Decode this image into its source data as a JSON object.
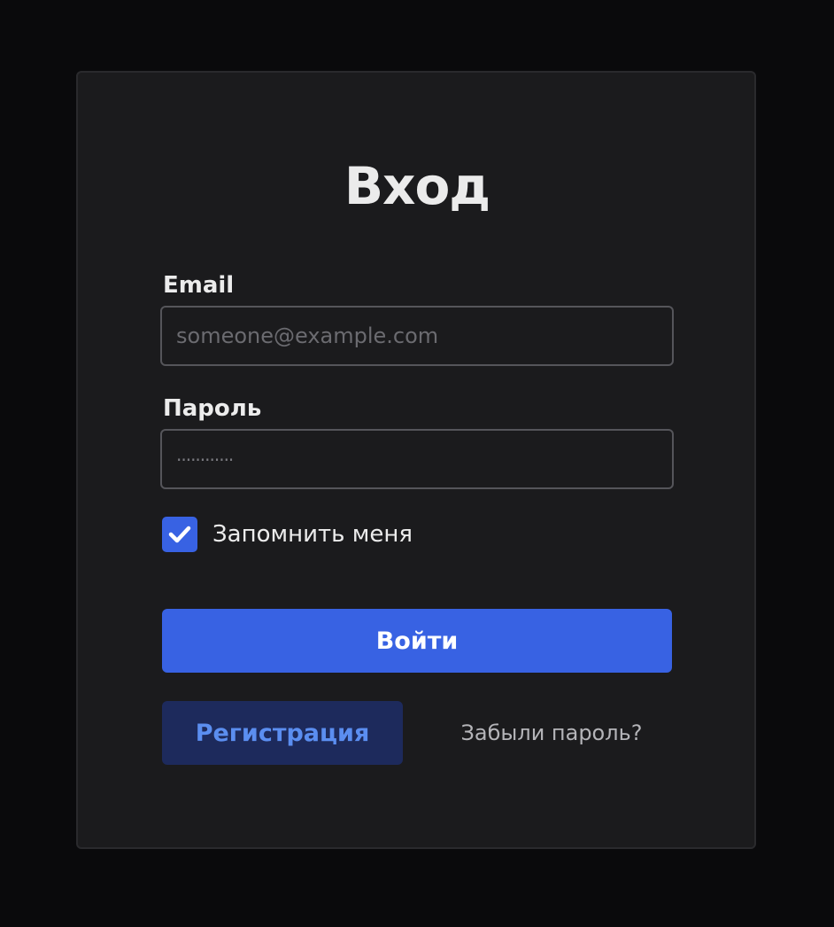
{
  "login": {
    "title": "Вход",
    "email_label": "Email",
    "email_placeholder": "someone@example.com",
    "email_value": "",
    "password_label": "Пароль",
    "password_placeholder": "············",
    "remember_label": "Запомнить меня",
    "remember_checked": true,
    "submit_label": "Войти",
    "register_label": "Регистрация",
    "forgot_label": "Забыли пароль?"
  },
  "icons": {
    "checkbox_icon": "checkmark-icon"
  },
  "colors": {
    "background": "#0a0a0c",
    "card": "#1b1b1d",
    "accent": "#3862e3",
    "secondary_button": "#1d2a5c",
    "secondary_text": "#5b8ef0"
  }
}
